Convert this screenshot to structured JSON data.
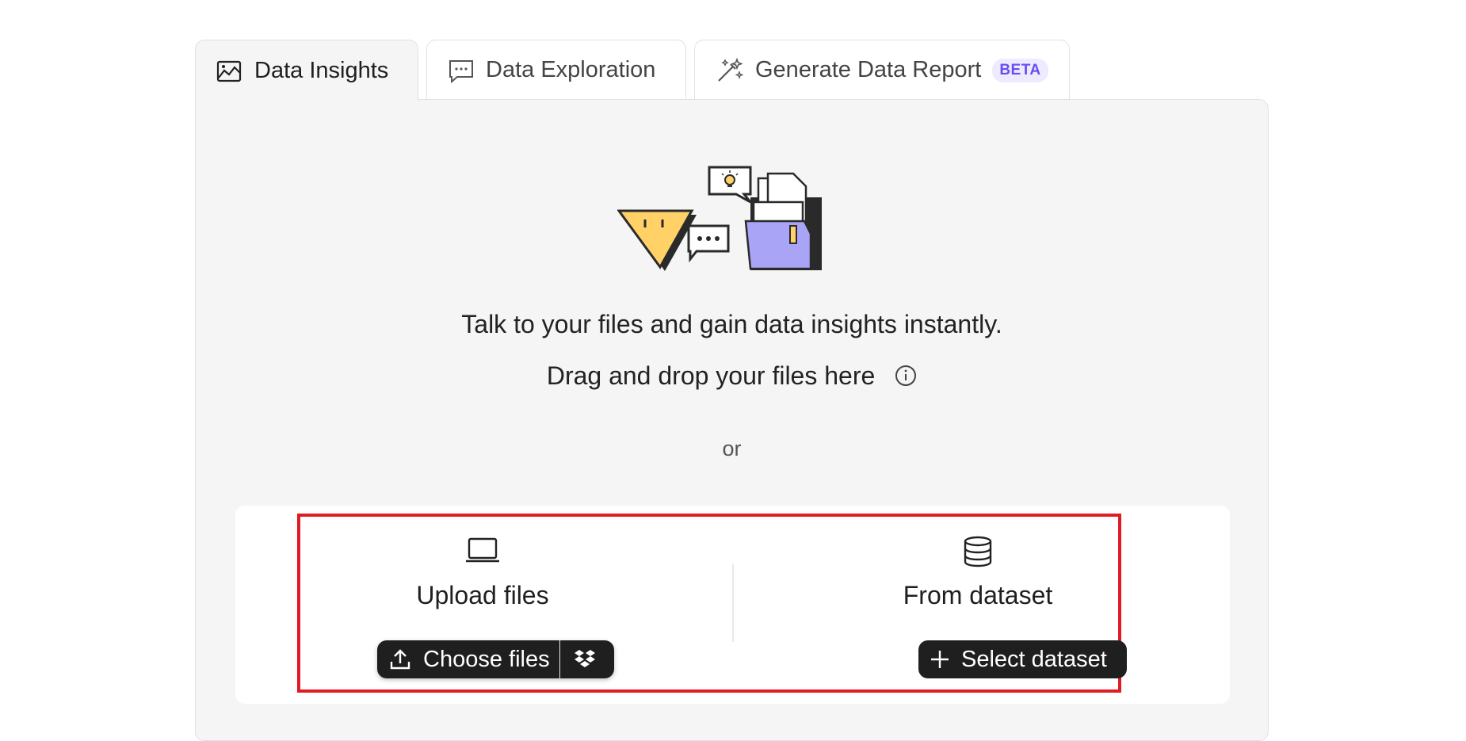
{
  "tabs": [
    {
      "label": "Data Insights",
      "icon": "image-chart-icon",
      "active": true
    },
    {
      "label": "Data Exploration",
      "icon": "chat-bubble-icon",
      "active": false
    },
    {
      "label": "Generate Data Report",
      "icon": "magic-wand-icon",
      "active": false,
      "badge": "BETA"
    }
  ],
  "main": {
    "headline": "Talk to your files and gain data insights instantly.",
    "drag_text": "Drag and drop your files here",
    "or_text": "or"
  },
  "upload": {
    "title": "Upload files",
    "button_label": "Choose files",
    "icon": "laptop-icon",
    "alt_icon": "dropbox-icon"
  },
  "dataset": {
    "title": "From dataset",
    "button_label": "Select dataset",
    "icon": "database-icon"
  },
  "colors": {
    "accent": "#6a4df0",
    "highlight": "#e01b24",
    "button": "#1f1f1f",
    "panel": "#f5f5f5",
    "folder": "#a9a4f5",
    "mascot": "#ffd166"
  }
}
